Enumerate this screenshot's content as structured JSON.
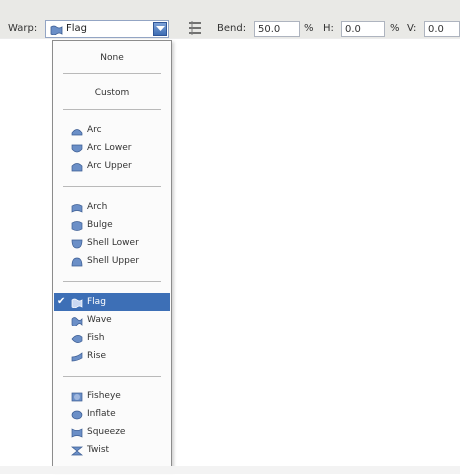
{
  "options_bar": {
    "warp_label": "Warp:",
    "warp_value": "Flag",
    "bend_label": "Bend:",
    "bend_value": "50.0",
    "bend_unit": "%",
    "h_label": "H:",
    "h_value": "0.0",
    "h_unit": "%",
    "v_label": "V:",
    "v_value": "0.0"
  },
  "warp_menu": {
    "items": [
      {
        "label": "None",
        "icon": null,
        "selected": false
      },
      {
        "label": "Custom",
        "icon": null,
        "selected": false
      },
      {
        "label": "Arc",
        "icon": "arc-icon",
        "selected": false
      },
      {
        "label": "Arc Lower",
        "icon": "arc-lower-icon",
        "selected": false
      },
      {
        "label": "Arc Upper",
        "icon": "arc-upper-icon",
        "selected": false
      },
      {
        "label": "Arch",
        "icon": "arch-icon",
        "selected": false
      },
      {
        "label": "Bulge",
        "icon": "bulge-icon",
        "selected": false
      },
      {
        "label": "Shell Lower",
        "icon": "shell-lower-icon",
        "selected": false
      },
      {
        "label": "Shell Upper",
        "icon": "shell-upper-icon",
        "selected": false
      },
      {
        "label": "Flag",
        "icon": "flag-icon",
        "selected": true
      },
      {
        "label": "Wave",
        "icon": "wave-icon",
        "selected": false
      },
      {
        "label": "Fish",
        "icon": "fish-icon",
        "selected": false
      },
      {
        "label": "Rise",
        "icon": "rise-icon",
        "selected": false
      },
      {
        "label": "Fisheye",
        "icon": "fisheye-icon",
        "selected": false
      },
      {
        "label": "Inflate",
        "icon": "inflate-icon",
        "selected": false
      },
      {
        "label": "Squeeze",
        "icon": "squeeze-icon",
        "selected": false
      },
      {
        "label": "Twist",
        "icon": "twist-icon",
        "selected": false
      }
    ]
  },
  "colors": {
    "selection": "#3d6fb6",
    "toolbar": "#e9e9e6",
    "icon_blue": "#6b8fc7"
  }
}
